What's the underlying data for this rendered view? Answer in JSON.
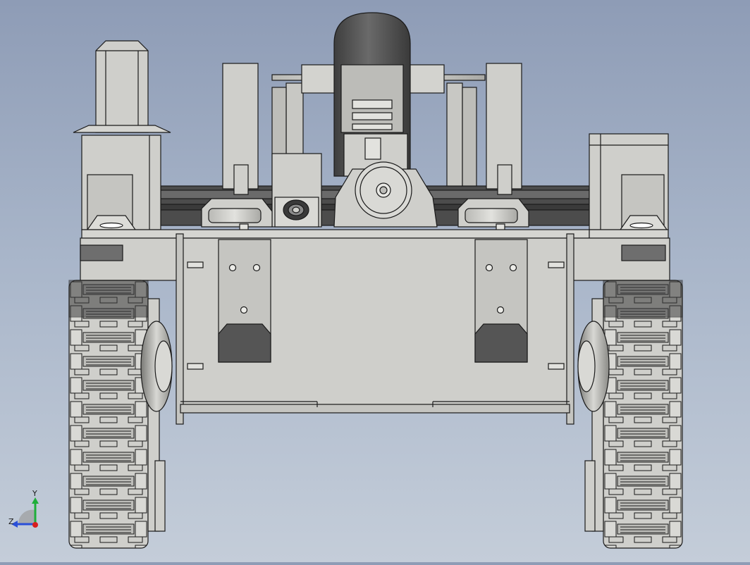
{
  "viewport": {
    "model": "tracked-robot-chassis",
    "view": "front",
    "colors": {
      "background_top": "#8e9cb6",
      "background_bottom": "#c4cdd9",
      "part_fill": "#cfcfcb",
      "part_dark": "#5a5a5a",
      "edge": "#1a1a1a"
    }
  },
  "triad": {
    "y_label": "Y",
    "z_label": "Z",
    "colors": {
      "y": "#1fae3a",
      "z": "#2a4fd8",
      "x": "#d81e1e"
    }
  }
}
